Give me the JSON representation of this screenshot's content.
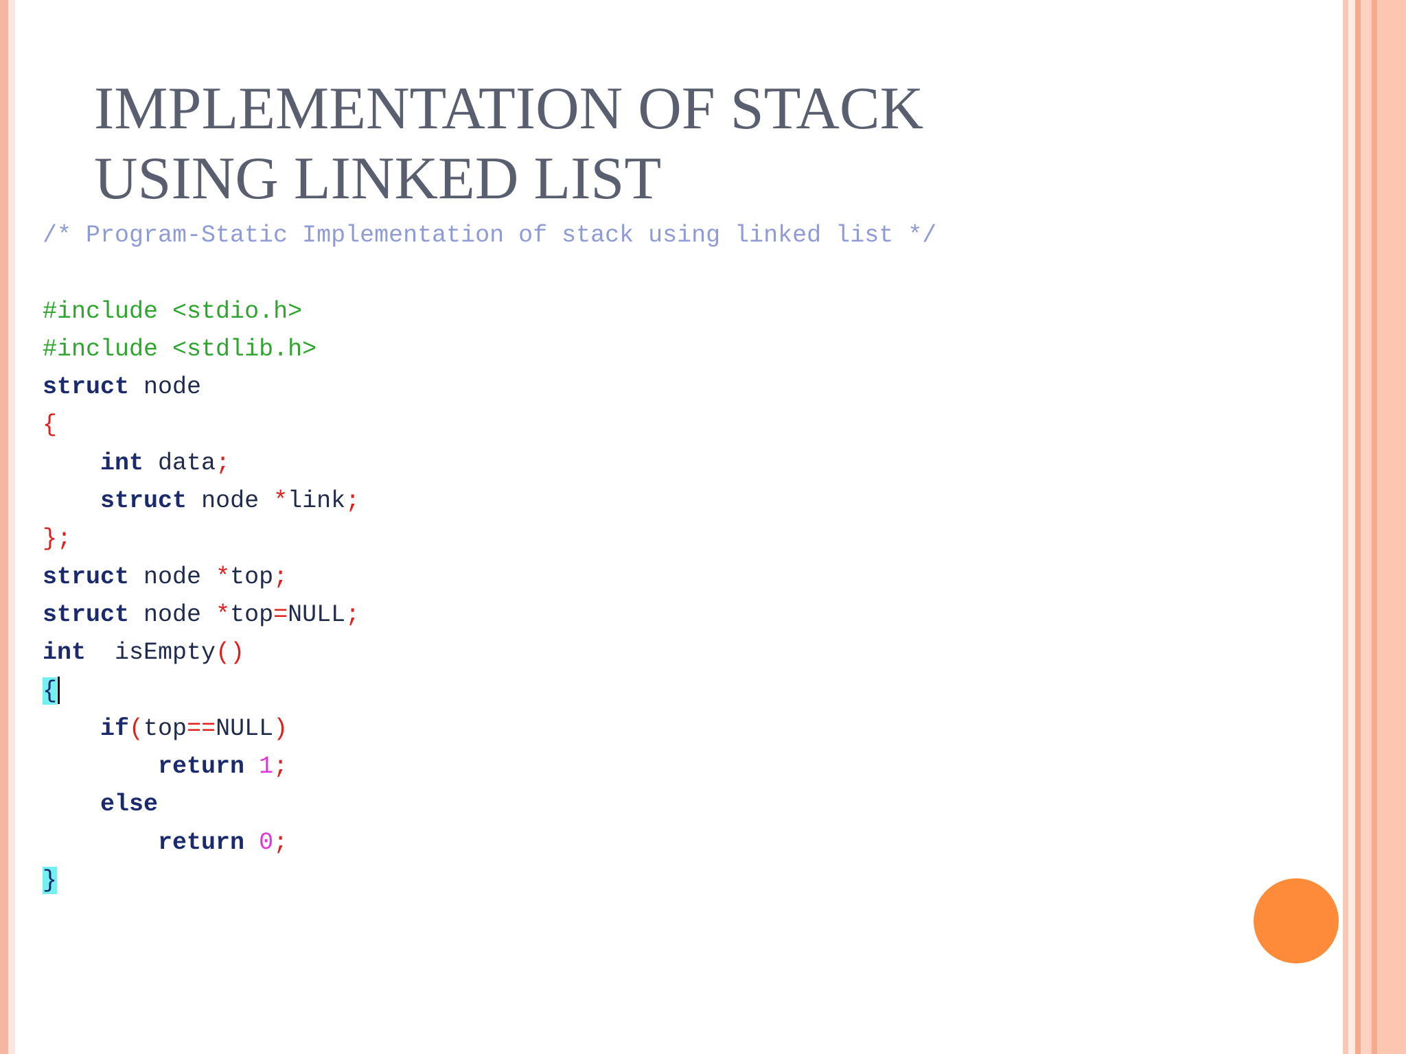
{
  "slide": {
    "title_line1": "IMPLEMENTATION OF STACK",
    "title_line2": "USING LINKED LIST"
  },
  "code": {
    "comment": "/* Program-Static Implementation of stack using linked list */",
    "include1_kw": "#include",
    "include1_hdr": "<stdio.h>",
    "include2_kw": "#include",
    "include2_hdr": "<stdlib.h>",
    "struct_kw": "struct",
    "struct_name": "node",
    "open_brace": "{",
    "field1_type": "int",
    "field1_name": "data",
    "field2_kw": "struct",
    "field2_type": "node",
    "field2_star": "*",
    "field2_name": "link",
    "close_struct": "};",
    "decl1_kw": "struct",
    "decl1_type": "node",
    "decl1_star": "*",
    "decl1_name": "top",
    "decl2_kw": "struct",
    "decl2_type": "node",
    "decl2_star": "*",
    "decl2_name": "top",
    "decl2_eq": "=",
    "decl2_null": "NULL",
    "fn_type": "int",
    "fn_name": "isEmpty",
    "fn_parens": "()",
    "fn_open": "{",
    "if_kw": "if",
    "if_open": "(",
    "if_var": "top",
    "if_eq": "==",
    "if_null": "NULL",
    "if_close": ")",
    "return1_kw": "return",
    "return1_val": "1",
    "else_kw": "else",
    "return0_kw": "return",
    "return0_val": "0",
    "fn_close": "}"
  },
  "colors": {
    "title": "#5a5f70",
    "comment": "#8f9bd6",
    "preprocessor": "#2ea52e",
    "keyword": "#1a2a6c",
    "punctuation": "#e0201c",
    "number": "#e033d8",
    "brace_highlight": "#74f0f0",
    "accent_dot": "#fd8b3a",
    "border": "#f5b6a2"
  }
}
